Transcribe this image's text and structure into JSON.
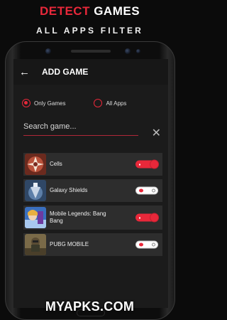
{
  "promo": {
    "title_accent": "DETECT",
    "title_rest": " GAMES",
    "subtitle": "ALL APPS FILTER"
  },
  "screen": {
    "title": "ADD GAME",
    "filters": [
      {
        "label": "Only Games",
        "selected": true
      },
      {
        "label": "All Apps",
        "selected": false
      }
    ],
    "search_placeholder": "Search game...",
    "games": [
      {
        "name": "Cells",
        "enabled": true,
        "icon": "cells-icon"
      },
      {
        "name": "Galaxy Shields",
        "enabled": false,
        "icon": "galaxy-shields-icon"
      },
      {
        "name": "Mobile Legends: Bang Bang",
        "enabled": true,
        "icon": "mobile-legends-icon"
      },
      {
        "name": "PUBG MOBILE",
        "enabled": false,
        "icon": "pubg-icon"
      }
    ]
  },
  "watermark": "MYAPKS.COM",
  "colors": {
    "accent": "#e8283a",
    "background": "#0b0b0b",
    "row": "#2d2d2d"
  }
}
